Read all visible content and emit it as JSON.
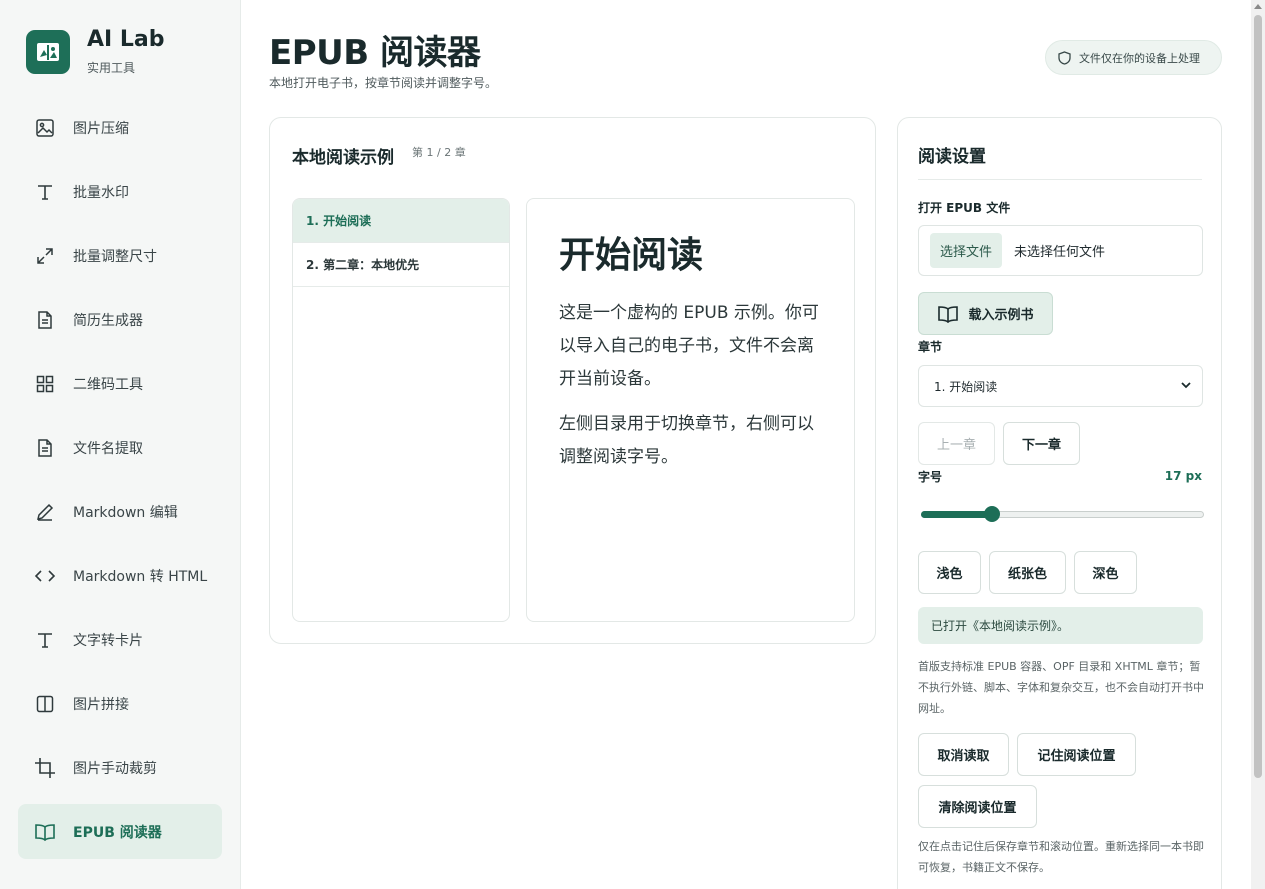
{
  "brand": {
    "name": "AI Lab",
    "subtitle": "实用工具"
  },
  "sidebar": {
    "items": [
      {
        "label": "图片压缩",
        "icon": "image-icon"
      },
      {
        "label": "批量水印",
        "icon": "text-icon"
      },
      {
        "label": "批量调整尺寸",
        "icon": "resize-icon"
      },
      {
        "label": "简历生成器",
        "icon": "document-icon"
      },
      {
        "label": "二维码工具",
        "icon": "grid-icon"
      },
      {
        "label": "文件名提取",
        "icon": "document-icon"
      },
      {
        "label": "Markdown 编辑",
        "icon": "pen-icon"
      },
      {
        "label": "Markdown 转 HTML",
        "icon": "code-icon"
      },
      {
        "label": "文字转卡片",
        "icon": "text-icon"
      },
      {
        "label": "图片拼接",
        "icon": "columns-icon"
      },
      {
        "label": "图片手动裁剪",
        "icon": "crop-icon"
      },
      {
        "label": "EPUB 阅读器",
        "icon": "book-icon",
        "active": true
      }
    ]
  },
  "header": {
    "title": "EPUB 阅读器",
    "subtitle": "本地打开电子书，按章节阅读并调整字号。",
    "badge": "文件仅在你的设备上处理"
  },
  "reader": {
    "title": "本地阅读示例",
    "progress": "第 1 / 2 章",
    "toc": [
      "1. 开始阅读",
      "2. 第二章：本地优先"
    ],
    "content": {
      "heading": "开始阅读",
      "paragraphs": [
        "这是一个虚构的 EPUB 示例。你可以导入自己的电子书，文件不会离开当前设备。",
        "左侧目录用于切换章节，右侧可以调整阅读字号。"
      ]
    }
  },
  "settings": {
    "title": "阅读设置",
    "open_label": "打开 EPUB 文件",
    "file_button": "选择文件",
    "file_status": "未选择任何文件",
    "load_sample": "载入示例书",
    "chapter_label": "章节",
    "chapter_selected": "1. 开始阅读",
    "prev": "上一章",
    "next": "下一章",
    "font_label": "字号",
    "font_value": "17 px",
    "font_slider": {
      "min": 12,
      "max": 32,
      "value": 17
    },
    "themes": [
      "浅色",
      "纸张色",
      "深色"
    ],
    "status": "已打开《本地阅读示例》。",
    "note": "首版支持标准 EPUB 容器、OPF 目录和 XHTML 章节；暂不执行外链、脚本、字体和复杂交互，也不会自动打开书中网址。",
    "cancel": "取消读取",
    "remember": "记住阅读位置",
    "clear": "清除阅读位置",
    "footer_note": "仅在点击记住后保存章节和滚动位置。重新选择同一本书即可恢复，书籍正文不保存。"
  },
  "colors": {
    "accent": "#1d6e57",
    "accent_soft": "#e3efe9"
  }
}
